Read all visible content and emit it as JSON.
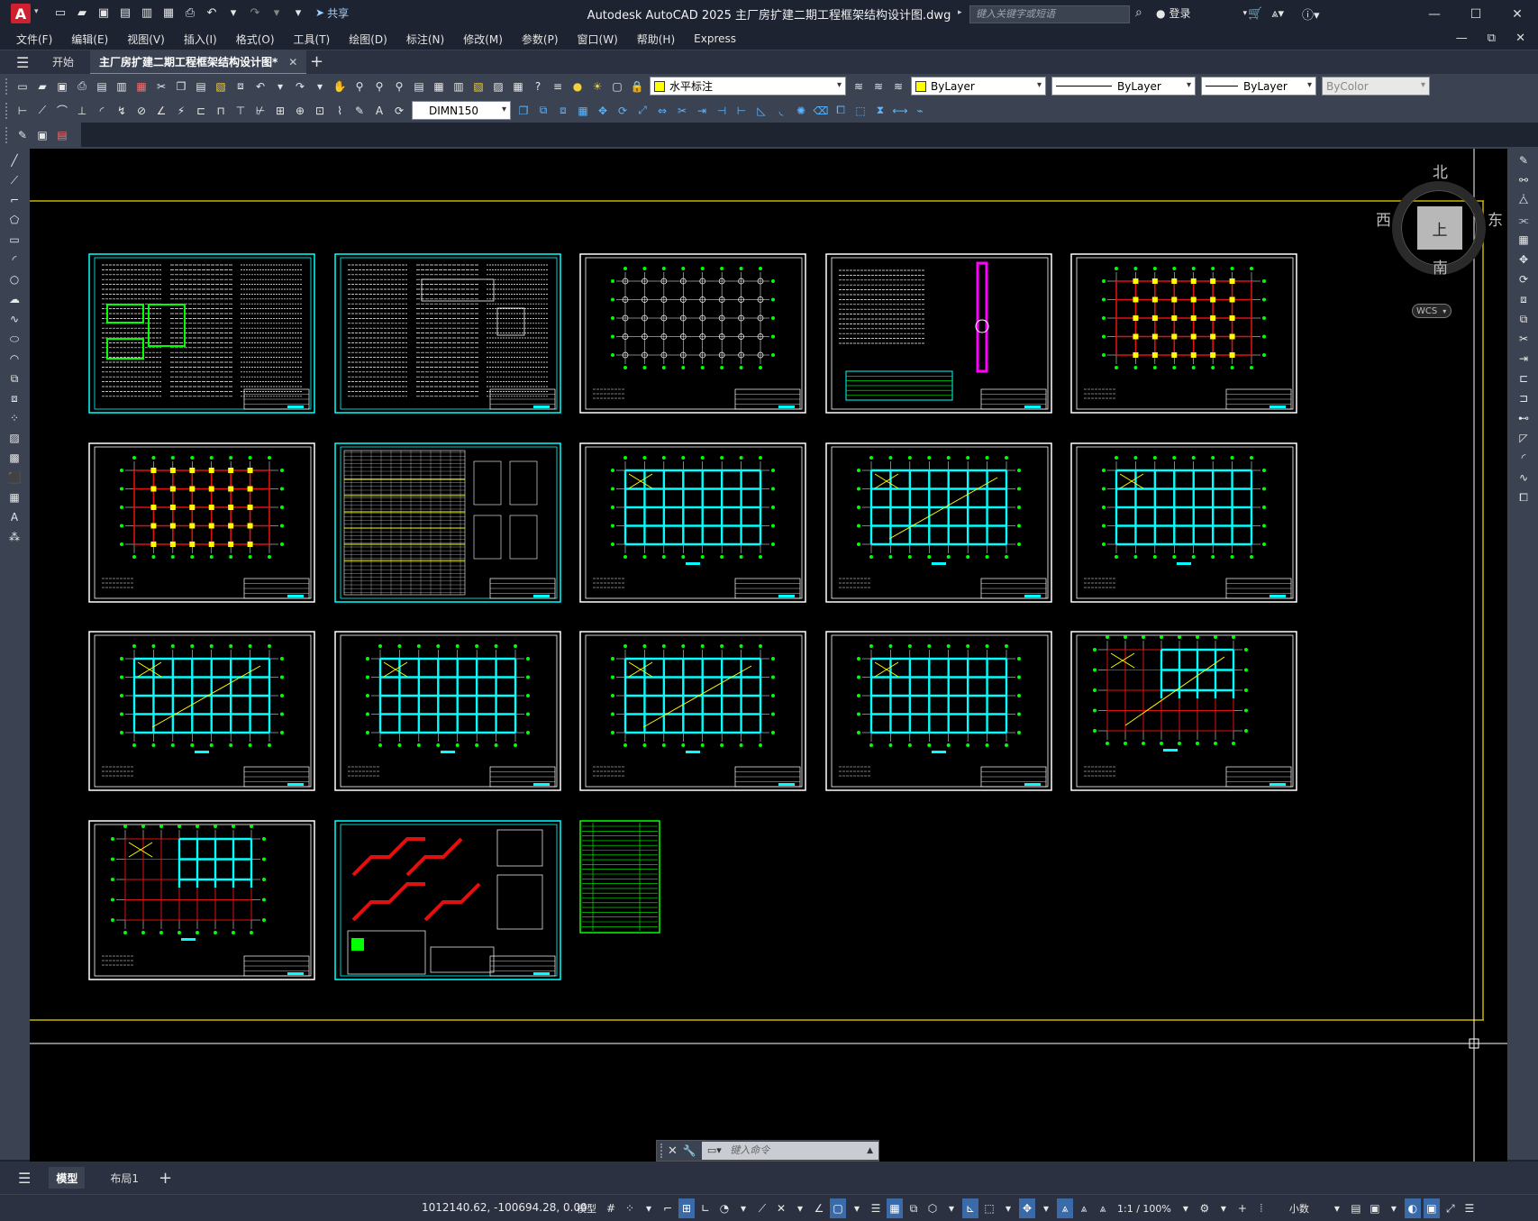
{
  "window": {
    "logo": "A",
    "title": "Autodesk AutoCAD 2025    主厂房扩建二期工程框架结构设计图.dwg",
    "search_placeholder": "键入关键字或短语",
    "login": "登录",
    "share": "共享"
  },
  "menu": {
    "items": [
      "文件(F)",
      "编辑(E)",
      "视图(V)",
      "插入(I)",
      "格式(O)",
      "工具(T)",
      "绘图(D)",
      "标注(N)",
      "修改(M)",
      "参数(P)",
      "窗口(W)",
      "帮助(H)",
      "Express"
    ]
  },
  "tabs": {
    "start": "开始",
    "file": "主厂房扩建二期工程框架结构设计图*"
  },
  "toolbar": {
    "layer_name": "水平标注",
    "layer_color": "#ffff00",
    "color_value": "ByLayer",
    "linetype_value": "ByLayer",
    "lineweight_value": "ByLayer",
    "plotstyle_value": "ByColor",
    "dimstyle_value": "DIMN150"
  },
  "viewcube": {
    "north": "北",
    "south": "南",
    "east": "东",
    "west": "西",
    "face": "上",
    "wcs": "WCS"
  },
  "command": {
    "placeholder": "键入命令"
  },
  "layouts": {
    "model": "模型",
    "layout1": "布局1"
  },
  "status": {
    "coords": "1012140.62, -100694.28, 0.00",
    "model": "模型",
    "scale": "1:1 / 100%",
    "units": "小数"
  },
  "colors": {
    "cyan": "#00ffff",
    "red": "#e01010",
    "yellow": "#ffff00",
    "green": "#00ff00",
    "magenta": "#ff00ff",
    "frame": "#ffffff"
  }
}
